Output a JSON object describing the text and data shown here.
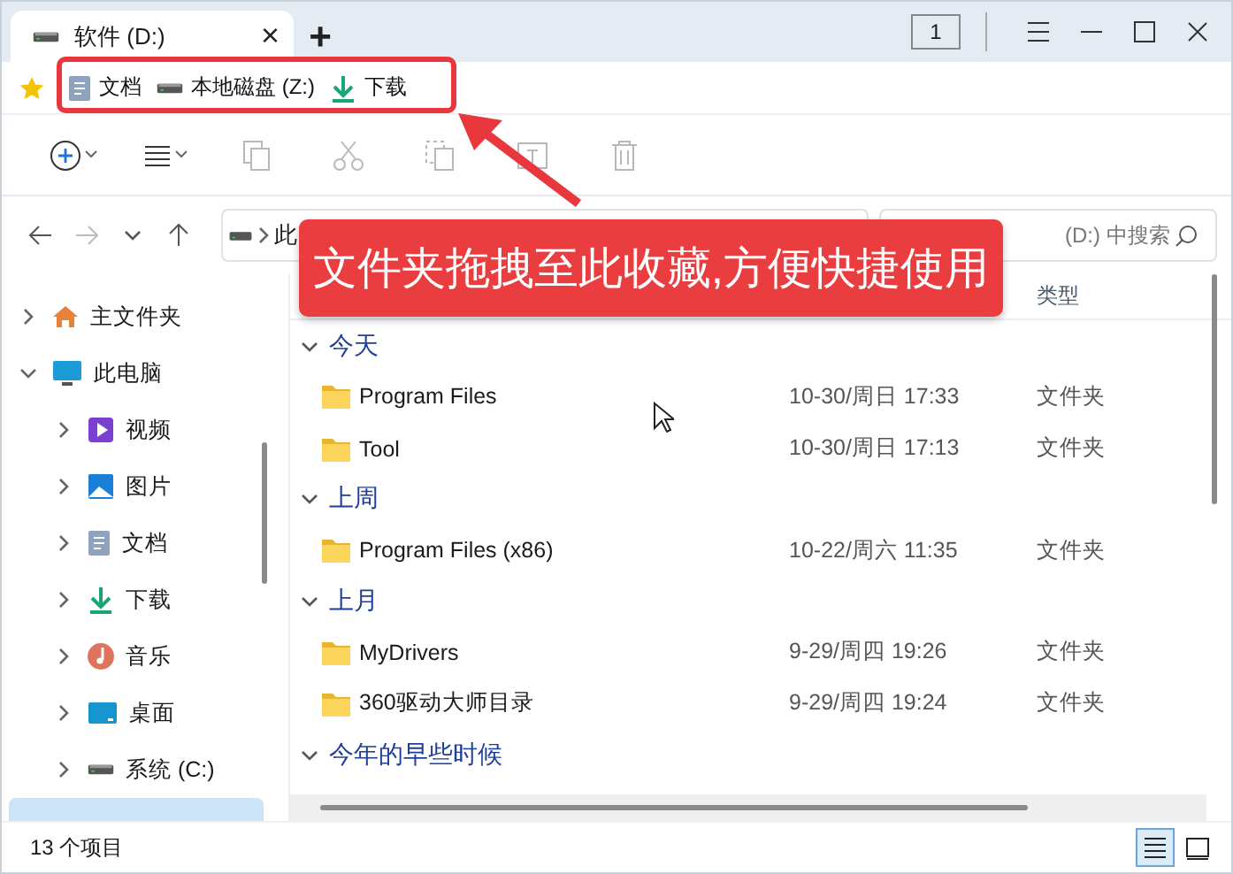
{
  "tabs": [
    {
      "label": "软件 (D:)",
      "selected": true,
      "close": "×"
    }
  ],
  "new_tab": "+",
  "window_controls": {
    "tab_count": "1"
  },
  "favorites": [
    {
      "label": "文档",
      "kind": "docs"
    },
    {
      "label": "本地磁盘 (Z:)",
      "kind": "drive"
    },
    {
      "label": "下载",
      "kind": "download"
    }
  ],
  "address": {
    "path": "此"
  },
  "search": {
    "placeholder": "(D:) 中搜索"
  },
  "columns": [
    {
      "label": "类型"
    }
  ],
  "sidebar": {
    "items": [
      {
        "label": "主文件夹",
        "kind": "home",
        "expanded": false,
        "selected": false
      },
      {
        "label": "此电脑",
        "kind": "pc",
        "expanded": true,
        "selected": false,
        "children": [
          {
            "label": "视频",
            "kind": "video",
            "expanded": false,
            "selected": false
          },
          {
            "label": "图片",
            "kind": "pictures",
            "expanded": false,
            "selected": false
          },
          {
            "label": "文档",
            "kind": "docs",
            "expanded": false,
            "selected": false
          },
          {
            "label": "下载",
            "kind": "download",
            "expanded": false,
            "selected": false
          },
          {
            "label": "音乐",
            "kind": "music",
            "expanded": false,
            "selected": false
          },
          {
            "label": "桌面",
            "kind": "desktop",
            "expanded": false,
            "selected": false
          },
          {
            "label": "系统 (C:)",
            "kind": "drive",
            "expanded": false,
            "selected": false
          },
          {
            "selected": true
          }
        ]
      }
    ]
  },
  "groups": [
    {
      "label": "今天",
      "expanded": true,
      "rows": [
        {
          "name": "Program Files",
          "date": "10-30/周日 17:33",
          "type": "文件夹"
        },
        {
          "name": "Tool",
          "date": "10-30/周日 17:13",
          "type": "文件夹"
        }
      ]
    },
    {
      "label": "上周",
      "expanded": true,
      "rows": [
        {
          "name": "Program Files (x86)",
          "date": "10-22/周六 11:35",
          "type": "文件夹"
        }
      ]
    },
    {
      "label": "上月",
      "expanded": true,
      "rows": [
        {
          "name": "MyDrivers",
          "date": "9-29/周四 19:26",
          "type": "文件夹"
        },
        {
          "name": "360驱动大师目录",
          "date": "9-29/周四 19:24",
          "type": "文件夹"
        }
      ]
    },
    {
      "label": "今年的早些时候",
      "expanded": true
    }
  ],
  "status_bar": {
    "count": "13 个项目",
    "views": [
      {
        "kind": "details",
        "selected": true
      },
      {
        "kind": "tiles",
        "selected": false
      }
    ]
  },
  "callout": {
    "text": "文件夹拖拽至此收藏,方便快捷使用"
  }
}
